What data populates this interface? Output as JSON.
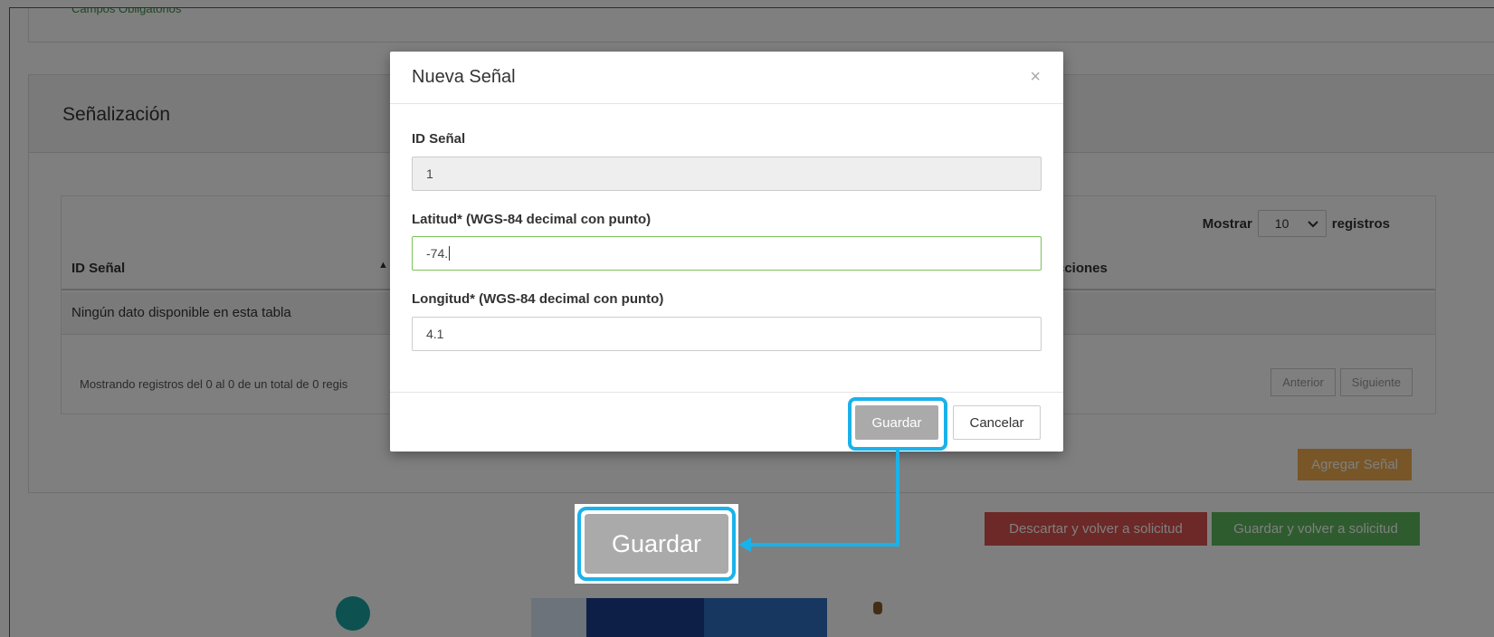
{
  "background": {
    "required_fields_note": "Campos Obligatorios",
    "panel_title": "Señalización",
    "show": {
      "prefix": "Mostrar",
      "value": "10",
      "suffix": "registros"
    },
    "columns": [
      "ID Señal",
      "cciones"
    ],
    "empty_message": "Ningún dato disponible en esta tabla",
    "info_text": "Mostrando registros del 0 al 0 de un total de 0 regis",
    "pager": {
      "prev": "Anterior",
      "next": "Siguiente"
    },
    "add_button": "Agregar Señal",
    "discard_button": "Descartar y volver a solicitud",
    "save_return_button": "Guardar y volver a solicitud"
  },
  "modal": {
    "title": "Nueva Señal",
    "close": "×",
    "fields": [
      {
        "label": "ID Señal",
        "value": "1"
      },
      {
        "label": "Latitud* (WGS-84 decimal con punto)",
        "value": "-74."
      },
      {
        "label": "Longitud* (WGS-84 decimal con punto)",
        "value": "4.1"
      }
    ],
    "save_button": "Guardar",
    "cancel_button": "Cancelar"
  },
  "callout": {
    "label": "Guardar"
  },
  "colors": {
    "highlight": "#1ab2ea",
    "success": "#5cb85c",
    "danger": "#d9534f",
    "warning": "#f0ad4e"
  },
  "icons": {
    "sort": "sort-asc-icon",
    "dropdown": "chevron-down-icon",
    "close": "close-icon"
  }
}
